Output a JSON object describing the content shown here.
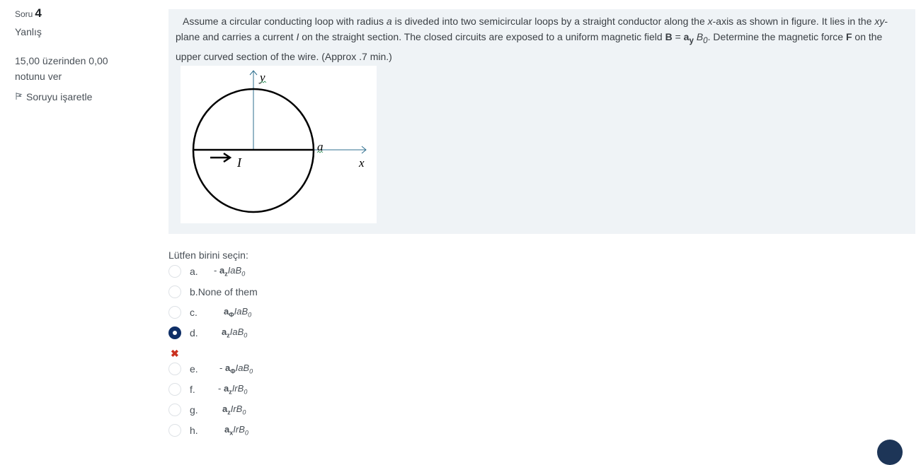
{
  "info": {
    "question_prefix": "Soru",
    "question_number": "4",
    "state": "Yanlış",
    "grade": "15,00 üzerinden 0,00 notunu ver",
    "flag_label": "Soruyu işaretle"
  },
  "question": {
    "p1": "Assume a circular conducting loop with radius ",
    "radius_symbol": "a",
    "p2": " is diveded into two semicircular loops by a straight conductor along the ",
    "x_symbol": "x",
    "p3": "-axis as shown in figure. It lies in the ",
    "xy_symbol": "xy",
    "p4": "-plane and carries a current ",
    "current_symbol": "I",
    "p5": " on the straight section. The closed circuits are exposed to a uniform magnetic field ",
    "B_symbol": "B",
    "p6": " = ",
    "ay_symbol": "a",
    "ay_sub": "y",
    "B0_symbol": "B",
    "B0_sub": "0",
    "p7": ". Determine the magnetic force ",
    "F_symbol": "F",
    "p8": " on the upper curved section of the wire. (Approx .7 min.)",
    "figure": {
      "y_label": "y",
      "x_label": "x",
      "a_label": "a",
      "I_label": "I"
    }
  },
  "prompt": "Lütfen birini seçin:",
  "options": [
    {
      "letter": "a.",
      "sign": "- ",
      "vec": "a",
      "sub": "z",
      "var": "IaB",
      "var_sub": "0"
    },
    {
      "letter": "b.",
      "text": "None of them"
    },
    {
      "letter": "c.",
      "sign": "",
      "vec": "a",
      "sub": "Φ",
      "var": "IaB",
      "var_sub": "0"
    },
    {
      "letter": "d.",
      "sign": "",
      "vec": "a",
      "sub": "z",
      "var": "IaB",
      "var_sub": "0"
    },
    {
      "letter": "e.",
      "sign": "- ",
      "vec": "a",
      "sub": "Φ",
      "var": "IaB",
      "var_sub": "0"
    },
    {
      "letter": "f.",
      "sign": "- ",
      "vec": "a",
      "sub": "z",
      "var": "IrB",
      "var_sub": "0"
    },
    {
      "letter": "g.",
      "sign": "",
      "vec": "a",
      "sub": "z",
      "var": "IrB",
      "var_sub": "0"
    },
    {
      "letter": "h.",
      "sign": "",
      "vec": "a",
      "sub": "x",
      "var": "IrB",
      "var_sub": "0"
    }
  ],
  "selected": "d.",
  "wrong_mark": "✖",
  "colors": {
    "selected_radio": "#0f2f67",
    "wrong": "#ca3120",
    "question_bg": "#eff3f6"
  }
}
